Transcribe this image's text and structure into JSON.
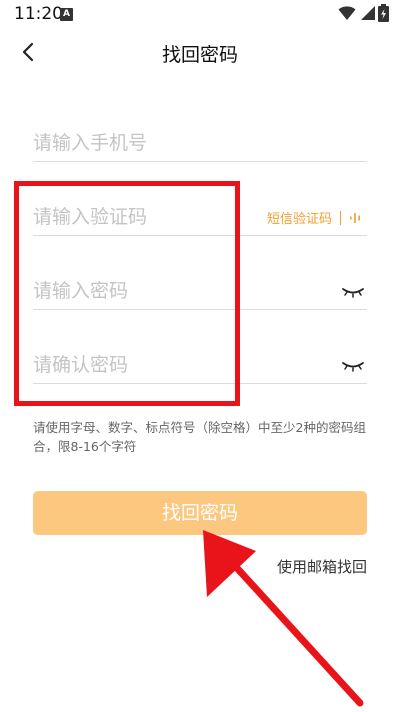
{
  "status_bar": {
    "time": "11:20",
    "notification_badge": "A",
    "icons": [
      "wifi-icon",
      "signal-icon",
      "battery-icon"
    ]
  },
  "header": {
    "title": "找回密码",
    "back_icon": "chevron-left-icon"
  },
  "form": {
    "phone_placeholder": "请输入手机号",
    "code_placeholder": "请输入验证码",
    "sms_button_label": "短信验证码",
    "voice_icon": "voice-wave-icon",
    "password_placeholder": "请输入密码",
    "confirm_placeholder": "请确认密码",
    "eye_icon": "eye-closed-icon",
    "hint": "请使用字母、数字、标点符号（除空格）中至少2种的密码组合，限8-16个字符",
    "submit_label": "找回密码",
    "email_link_label": "使用邮箱找回"
  },
  "colors": {
    "accent": "#f0a030",
    "button_bg": "#fcc77f",
    "annotation": "#e8141a",
    "divider": "#dcdcdc"
  }
}
